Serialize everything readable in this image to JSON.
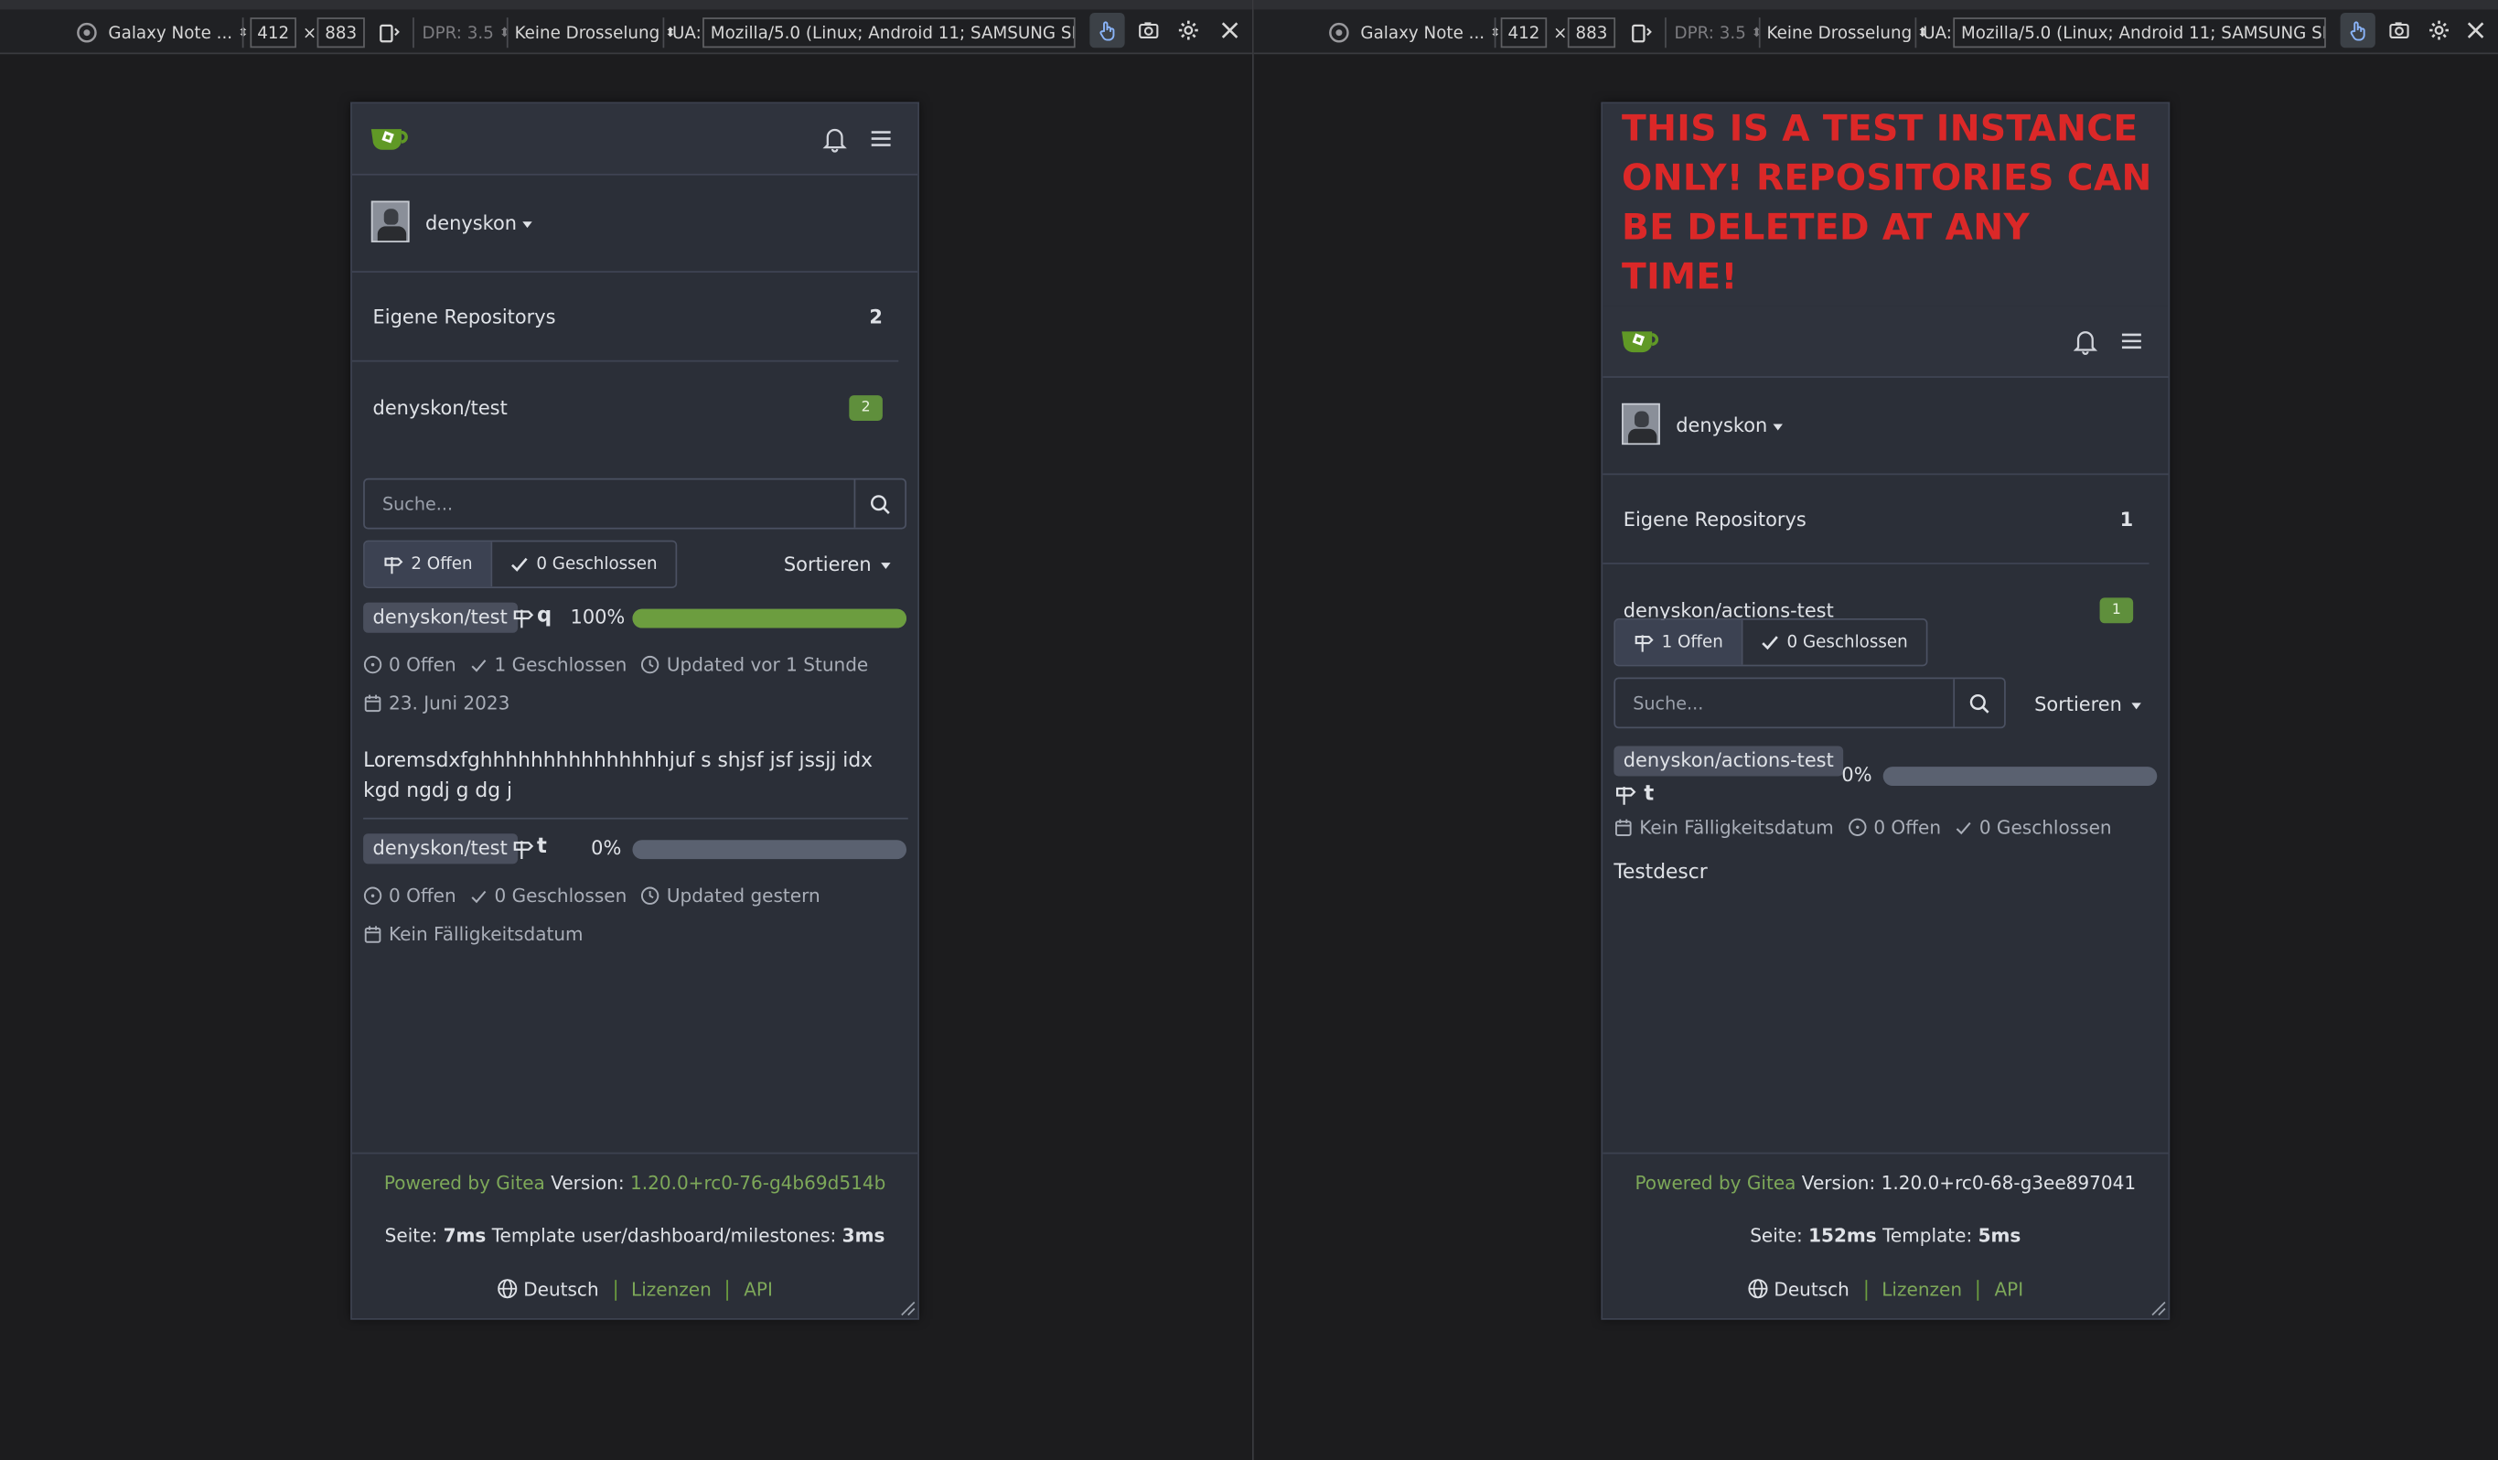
{
  "devtools": {
    "left": {
      "device": "Galaxy Note ...",
      "width": "412",
      "height": "883",
      "dpr": "DPR: 3.5",
      "throttle": "Keine Drosselung",
      "ua_label": "UA:",
      "ua_value": "Mozilla/5.0 (Linux; Android 11; SAMSUNG SM-G97"
    },
    "right": {
      "device": "Galaxy Note ...",
      "width": "412",
      "height": "883",
      "dpr": "DPR: 3.5",
      "throttle": "Keine Drosselung",
      "ua_label": "UA:",
      "ua_value": "Mozilla/5.0 (Linux; Android 11; SAMSUNG SM-G97"
    },
    "times": "×"
  },
  "left_page": {
    "user": "denyskon",
    "repo_header": {
      "label": "Eigene Repositorys",
      "count": "2"
    },
    "repo_item": {
      "label": "denyskon/test",
      "badge": "2"
    },
    "search_placeholder": "Suche...",
    "open_label": "2 Offen",
    "closed_label": "0 Geschlossen",
    "sort_label": "Sortieren",
    "milestones": [
      {
        "repo": "denyskon/test",
        "name": "q",
        "percent": "100%",
        "progress": 1.0,
        "open": "0 Offen",
        "closed": "1 Geschlossen",
        "updated": "Updated vor 1 Stunde",
        "due": "23. Juni 2023",
        "description": "Loremsdxfghhhhhhhhhhhhhhhjuf s shjsf jsf jssjj idx kgd ngdj g dg j"
      },
      {
        "repo": "denyskon/test",
        "name": "t",
        "percent": "0%",
        "progress": 0.0,
        "open": "0 Offen",
        "closed": "0 Geschlossen",
        "updated": "Updated gestern",
        "due": "Kein Fälligkeitsdatum"
      }
    ],
    "footer": {
      "powered": "Powered by Gitea",
      "version_label": "Version:",
      "version": "1.20.0+rc0-76-g4b69d514b",
      "page_label": "Seite:",
      "page_time": "7ms",
      "template_label": "Template user/dashboard/milestones:",
      "template_time": "3ms",
      "language": "Deutsch",
      "licenses": "Lizenzen",
      "api": "API"
    }
  },
  "right_page": {
    "banner": "THIS IS A TEST INSTANCE ONLY! REPOSITORIES CAN BE DELETED AT ANY TIME!",
    "user": "denyskon",
    "repo_header": {
      "label": "Eigene Repositorys",
      "count": "1"
    },
    "repo_item": {
      "label": "denyskon/actions-test",
      "badge": "1"
    },
    "search_placeholder": "Suche...",
    "open_label": "1 Offen",
    "closed_label": "0 Geschlossen",
    "sort_label": "Sortieren",
    "milestone": {
      "repo": "denyskon/actions-test",
      "name": "t",
      "percent": "0%",
      "progress": 0.0,
      "due": "Kein Fälligkeitsdatum",
      "open": "0 Offen",
      "closed": "0 Geschlossen",
      "description": "Testdescr"
    },
    "footer": {
      "powered": "Powered by Gitea",
      "version_label": "Version:",
      "version": "1.20.0+rc0-68-g3ee897041",
      "page_label": "Seite:",
      "page_time": "152ms",
      "template_label": "Template:",
      "template_time": "5ms",
      "language": "Deutsch",
      "licenses": "Lizenzen",
      "api": "API"
    }
  },
  "colors": {
    "accent_green": "#6c9d3f",
    "banner_red": "#db2828",
    "background": "#1c1c1e",
    "panel": "#2b2f38"
  }
}
